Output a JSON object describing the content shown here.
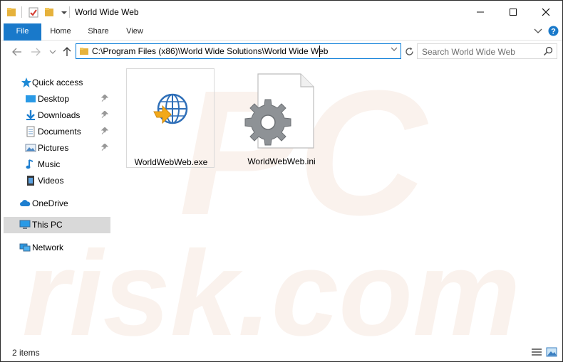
{
  "window": {
    "title": "World Wide Web"
  },
  "ribbon": {
    "tabs": [
      "File",
      "Home",
      "Share",
      "View"
    ]
  },
  "address": {
    "path": "C:\\Program Files (x86)\\World Wide Solutions\\World Wide Web"
  },
  "search": {
    "placeholder": "Search World Wide Web"
  },
  "sidebar": {
    "quick_access": "Quick access",
    "items": [
      {
        "label": "Desktop",
        "icon": "desktop-icon",
        "pinned": true
      },
      {
        "label": "Downloads",
        "icon": "downloads-icon",
        "pinned": true
      },
      {
        "label": "Documents",
        "icon": "documents-icon",
        "pinned": true
      },
      {
        "label": "Pictures",
        "icon": "pictures-icon",
        "pinned": true
      },
      {
        "label": "Music",
        "icon": "music-icon",
        "pinned": false
      },
      {
        "label": "Videos",
        "icon": "videos-icon",
        "pinned": false
      }
    ],
    "onedrive": "OneDrive",
    "this_pc": "This PC",
    "network": "Network"
  },
  "files": [
    {
      "name": "WorldWebWeb.exe",
      "icon": "globe-exe-icon"
    },
    {
      "name": "WorldWebWeb.ini",
      "icon": "settings-file-icon"
    }
  ],
  "status": {
    "item_count": "2 items"
  },
  "colors": {
    "accent": "#1979ca",
    "selection": "#d9d9d9"
  }
}
